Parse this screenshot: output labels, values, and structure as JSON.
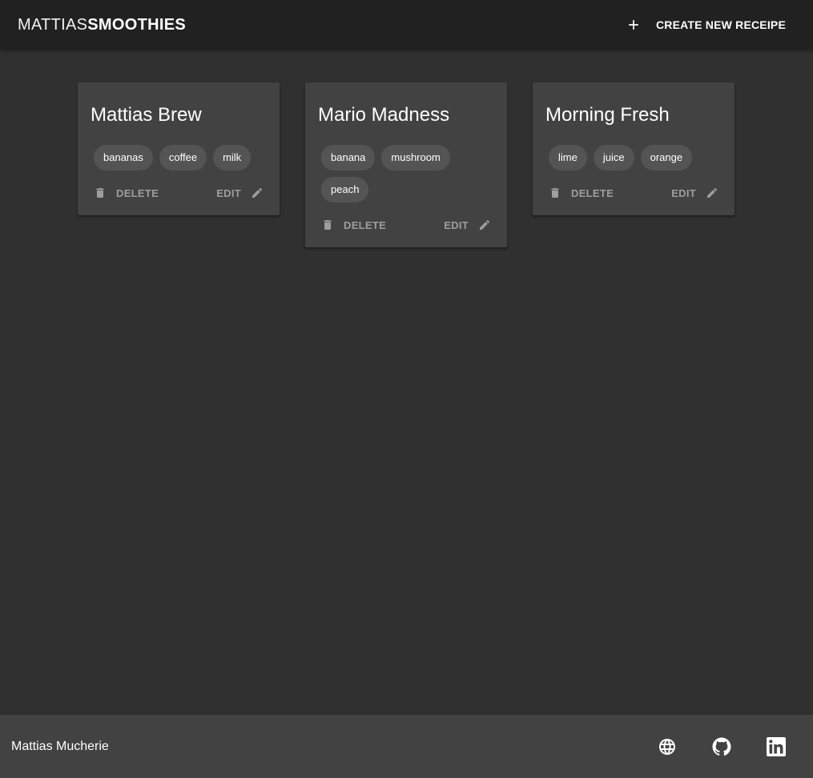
{
  "header": {
    "brand_light": "MATTIAS",
    "brand_bold": "SMOOTHIES",
    "create_label": "CREATE NEW RECEIPE",
    "create_icon": "plus-icon"
  },
  "recipes": [
    {
      "title": "Mattias Brew",
      "ingredients": [
        "bananas",
        "coffee",
        "milk"
      ],
      "delete_label": "DELETE",
      "edit_label": "EDIT"
    },
    {
      "title": "Mario Madness",
      "ingredients": [
        "banana",
        "mushroom",
        "peach"
      ],
      "delete_label": "DELETE",
      "edit_label": "EDIT"
    },
    {
      "title": "Morning Fresh",
      "ingredients": [
        "lime",
        "juice",
        "orange"
      ],
      "delete_label": "DELETE",
      "edit_label": "EDIT"
    }
  ],
  "footer": {
    "author": "Mattias Mucherie",
    "links": [
      {
        "icon": "globe-icon"
      },
      {
        "icon": "github-icon"
      },
      {
        "icon": "linkedin-icon"
      }
    ]
  },
  "colors": {
    "background": "#303030",
    "appbar": "#212121",
    "card": "#424242",
    "chip": "#545454",
    "muted_text": "#9e9e9e"
  }
}
